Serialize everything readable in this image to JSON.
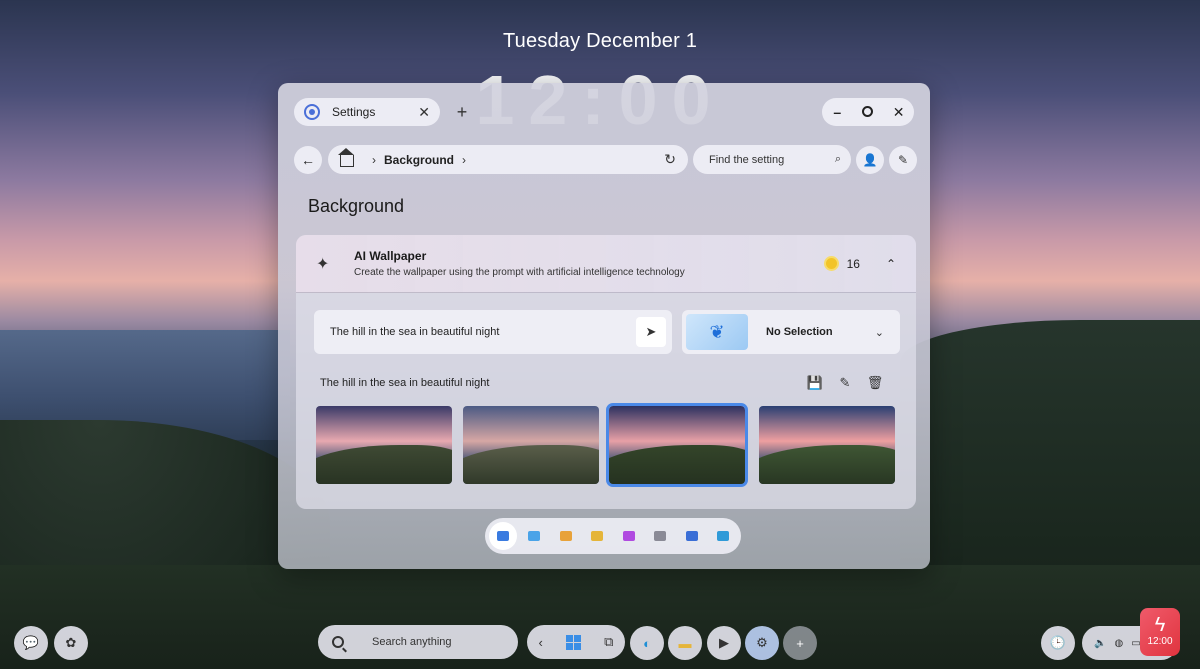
{
  "lockscreen": {
    "date": "Tuesday December 1",
    "time": "12:00"
  },
  "window": {
    "tab": {
      "label": "Settings",
      "icon": "gear-icon"
    },
    "controls": {
      "minimize": "–",
      "close": "✕"
    },
    "address": {
      "crumb": "Background"
    },
    "find": {
      "placeholder": "Find the setting"
    },
    "page_title": "Background"
  },
  "ai_wallpaper": {
    "title": "AI Wallpaper",
    "description": "Create the wallpaper using the prompt with artificial intelligence technology",
    "credits": "16",
    "prompt_value": "The hill in the sea in beautiful night",
    "style_selection": "No Selection",
    "result_label": "The hill in the sea in beautiful night",
    "thumbnails": [
      {
        "selected": false,
        "sky_top": "#3a3a68",
        "sky_bottom": "#e8a9b0",
        "land": "#3f4a34"
      },
      {
        "selected": false,
        "sky_top": "#4b5a84",
        "sky_bottom": "#d6a7a4",
        "land": "#5a5e4a"
      },
      {
        "selected": true,
        "sky_top": "#2c3160",
        "sky_bottom": "#e7a0a6",
        "land": "#34452a"
      },
      {
        "selected": false,
        "sky_top": "#2a3f72",
        "sky_bottom": "#ee9fa0",
        "land": "#3f5634"
      }
    ]
  },
  "dock_icons": [
    "image-icon",
    "paint-icon",
    "brush-icon",
    "folder-icon",
    "palette-icon",
    "keyboard-icon",
    "screen-icon",
    "monitor-icon"
  ],
  "taskbar": {
    "search_placeholder": "Search anything",
    "badge_time": "12:00"
  }
}
